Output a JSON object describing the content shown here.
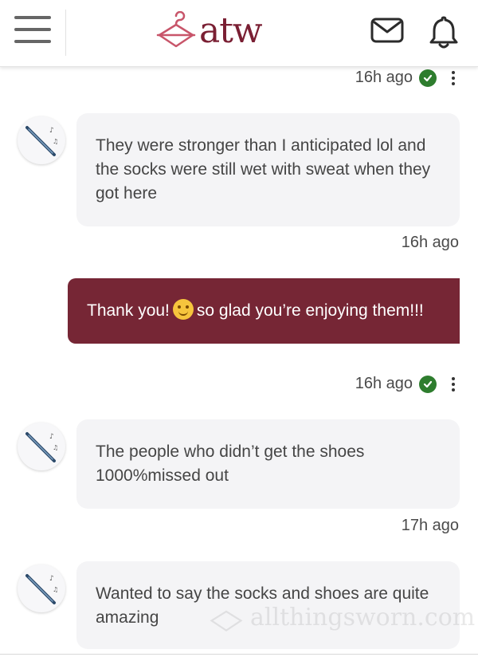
{
  "header": {
    "logo_text": "atw",
    "menu_icon": "hamburger-menu-icon",
    "mail_icon": "mail-icon",
    "bell_icon": "bell-icon"
  },
  "colors": {
    "brand": "#7a1f33",
    "outgoing_bubble": "#762635",
    "incoming_bubble": "#f4f4f6",
    "read_check": "#2e7d2e"
  },
  "messages": [
    {
      "direction": "out",
      "time": "16h ago",
      "read": true,
      "text": ""
    },
    {
      "direction": "in",
      "text": "They were stronger than I anticipated lol and the socks were still wet with sweat when they got here",
      "time": "16h ago"
    },
    {
      "direction": "out",
      "text_before": "Thank you!",
      "emoji": "smiling-face",
      "text_after": "so glad you’re enjoying them!!!",
      "time": "16h ago",
      "read": true
    },
    {
      "direction": "in",
      "text": "The people who didn’t get the shoes 1000%missed out",
      "time": "17h ago"
    },
    {
      "direction": "in",
      "text": "Wanted to say the socks and shoes are quite amazing",
      "time": ""
    }
  ],
  "watermark": {
    "text": "allthingsworn.com"
  }
}
